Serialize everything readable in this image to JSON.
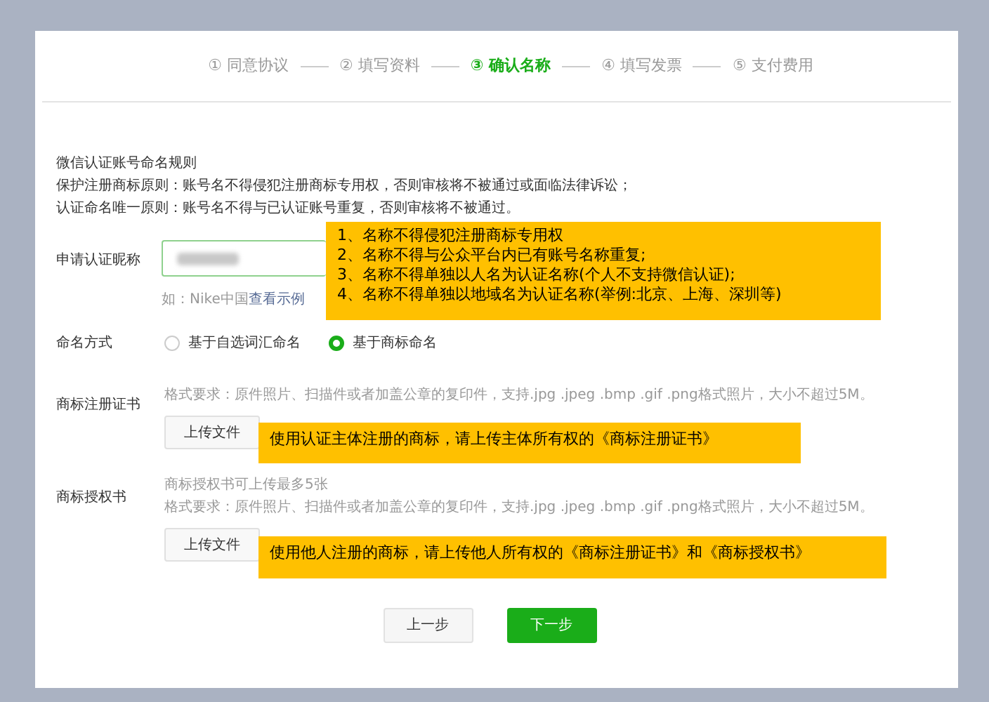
{
  "steps": [
    {
      "number": "①",
      "label": "同意协议",
      "selected": false
    },
    {
      "number": "②",
      "label": "填写资料",
      "selected": false
    },
    {
      "number": "③",
      "label": "确认名称",
      "selected": true
    },
    {
      "number": "④",
      "label": "填写发票",
      "selected": false
    },
    {
      "number": "⑤",
      "label": "支付费用",
      "selected": false
    }
  ],
  "rules": {
    "title": "微信认证账号命名规则",
    "lines": [
      "保护注册商标原则：账号名不得侵犯注册商标专用权，否则审核将不被通过或面临法律诉讼；",
      "认证命名唯一原则：账号名不得与已认证账号重复，否则审核将不被通过。"
    ]
  },
  "name_field": {
    "label": "申请认证昵称",
    "example_prefix": "如：Nike中国",
    "example_link": "查看示例"
  },
  "naming": {
    "label": "命名方式",
    "options": [
      {
        "label": "基于自选词汇命名",
        "selected": false
      },
      {
        "label": "基于商标命名",
        "selected": true
      }
    ]
  },
  "uploads": [
    {
      "label": "商标注册证书",
      "hints": [
        "格式要求：原件照片、扫描件或者加盖公章的复印件，支持.jpg .jpeg .bmp .gif .png格式照片，大小不超过5M。"
      ],
      "button": "上传文件"
    },
    {
      "label": "商标授权书",
      "hints": [
        "商标授权书可上传最多5张",
        "格式要求：原件照片、扫描件或者加盖公章的复印件，支持.jpg .jpeg .bmp .gif .png格式照片，大小不超过5M。"
      ],
      "button": "上传文件"
    }
  ],
  "callouts": [
    {
      "lines": [
        "1、名称不得侵犯注册商标专用权",
        "2、名称不得与公众平台内已有账号名称重复;",
        "3、名称不得单独以人名为认证名称(个人不支持微信认证);",
        "4、名称不得单独以地域名为认证名称(举例:北京、上海、深圳等)"
      ]
    },
    {
      "lines": [
        "使用认证主体注册的商标，请上传主体所有权的《商标注册证书》"
      ]
    },
    {
      "lines": [
        "使用他人注册的商标，请上传他人所有权的《商标注册证书》和《商标授权书》"
      ]
    }
  ],
  "buttons": {
    "prev": "上一步",
    "next": "下一步"
  }
}
